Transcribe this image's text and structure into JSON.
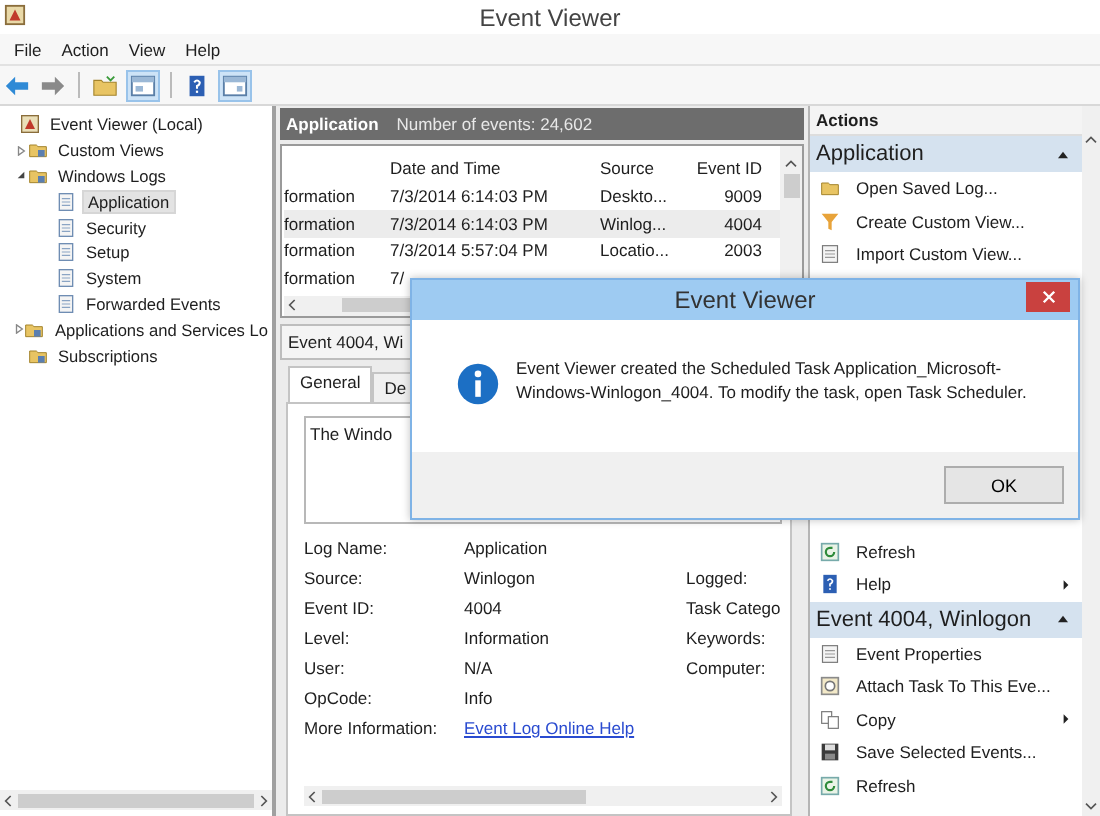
{
  "window": {
    "title": "Event Viewer"
  },
  "menu": [
    "File",
    "Action",
    "View",
    "Help"
  ],
  "tree": [
    {
      "label": "Event Viewer (Local)",
      "selected": false,
      "children": [
        {
          "label": "Custom Views",
          "selected": false,
          "expanded": false
        },
        {
          "label": "Windows Logs",
          "selected": false,
          "expanded": true,
          "children": [
            {
              "label": "Application",
              "selected": true
            },
            {
              "label": "Security",
              "selected": false
            },
            {
              "label": "Setup",
              "selected": false
            },
            {
              "label": "System",
              "selected": false
            },
            {
              "label": "Forwarded Events",
              "selected": false
            }
          ]
        },
        {
          "label": "Applications and Services Lo",
          "selected": false,
          "expanded": false
        },
        {
          "label": "Subscriptions",
          "selected": false
        }
      ]
    }
  ],
  "log_header": {
    "title": "Application",
    "count": "Number of events: 24,602"
  },
  "events_table": {
    "columns": [
      "Date and Time",
      "Source",
      "Event ID"
    ],
    "rows": [
      {
        "column_1": "formation",
        "date_and_time": "7/3/2014 6:14:03 PM",
        "source": "Deskto...",
        "event_id": "9009",
        "selected": false
      },
      {
        "column_1": "formation",
        "date_and_time": "7/3/2014 6:14:03 PM",
        "source": "Winlog...",
        "event_id": "4004",
        "selected": true
      },
      {
        "column_1": "formation",
        "date_and_time": "7/3/2014 5:57:04 PM",
        "source": "Locatio...",
        "event_id": "2003",
        "selected": false
      },
      {
        "column_1": "formation",
        "date_and_time": "7/",
        "selected": false
      }
    ]
  },
  "event_panel": {
    "title": "Event 4004, Wi",
    "tabs": [
      {
        "label": "General",
        "selected": true
      },
      {
        "label": "De",
        "selected": false
      }
    ],
    "description": "The Windo",
    "fields": [
      {
        "label": "Log Name:",
        "value": "Application"
      },
      {
        "label": "Source:",
        "value": "Winlogon",
        "side_label": "Logged:"
      },
      {
        "label": "Event ID:",
        "value": "4004",
        "side_label": "Task Catego"
      },
      {
        "label": "Level:",
        "value": "Information",
        "side_label": "Keywords:"
      },
      {
        "label": "User:",
        "value": "N/A",
        "side_label": "Computer:"
      },
      {
        "label": "OpCode:",
        "value": "Info"
      }
    ],
    "more_info": {
      "label": "More Information:",
      "link": "Event Log Online Help"
    }
  },
  "actions": {
    "title": "Actions",
    "sections": [
      {
        "title": "Application",
        "items": [
          {
            "label": "Open Saved Log...",
            "has_submenu": false
          },
          {
            "label": "Create Custom View...",
            "has_submenu": false
          },
          {
            "label": "Import Custom View...",
            "has_submenu": false
          },
          {
            "label": "Refresh",
            "has_submenu": false
          },
          {
            "label": "Help",
            "has_submenu": true
          }
        ]
      },
      {
        "title": "Event 4004, Winlogon",
        "items": [
          {
            "label": "Event Properties",
            "has_submenu": false
          },
          {
            "label": "Attach Task To This Eve...",
            "has_submenu": false
          },
          {
            "label": "Copy",
            "has_submenu": true
          },
          {
            "label": "Save Selected Events...",
            "has_submenu": false
          },
          {
            "label": "Refresh",
            "has_submenu": false
          }
        ]
      }
    ]
  },
  "dialog": {
    "title": "Event Viewer",
    "message": "Event Viewer created the Scheduled Task Application_Microsoft-Windows-Winlogon_4004. To modify the task, open Task Scheduler.",
    "button": "OK"
  }
}
